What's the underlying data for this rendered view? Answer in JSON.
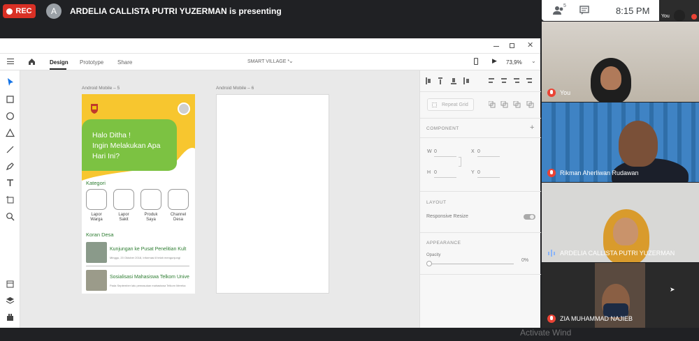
{
  "meet": {
    "rec_label": "REC",
    "presenter_initial": "A",
    "presenting_text": "ARDELIA CALLISTA PUTRI YUZERMAN is presenting",
    "participants_count": "5",
    "time": "8:15 PM",
    "self_mini_label": "You"
  },
  "xd": {
    "tabs": [
      "Design",
      "Prototype",
      "Share"
    ],
    "doc_title": "SMART VILLAGE *",
    "zoom": "73,9%",
    "artboard1_label": "Android Mobile – 5",
    "artboard2_label": "Android Mobile – 6",
    "app": {
      "greeting": "Halo Ditha !",
      "question_line1": "Ingin Melakukan Apa",
      "question_line2": "Hari Ini?",
      "kategori_label": "Kategori",
      "categories": [
        {
          "line1": "Lapor",
          "line2": "Warga"
        },
        {
          "line1": "Lapor",
          "line2": "Sakit"
        },
        {
          "line1": "Produk",
          "line2": "Saya"
        },
        {
          "line1": "Channel",
          "line2": "Desa"
        }
      ],
      "koran_label": "Koran Desa",
      "news": [
        {
          "title": "Kunjungan ke Pusat Penelitian Kult",
          "sub": "Minggu, 20 Oktober 2018, Informasi 8 telah mengunjungi"
        },
        {
          "title": "Sosialisasi Mahasiswa Telkom Unive",
          "sub": "Pada September lalu pemasukan mahasiswa Telkom Mereka"
        }
      ]
    },
    "panel": {
      "repeat_grid": "Repeat Grid",
      "component": "COMPONENT",
      "w_label": "W",
      "w_value": "0",
      "x_label": "X",
      "x_value": "0",
      "h_label": "H",
      "h_value": "0",
      "y_label": "Y",
      "y_value": "0",
      "layout": "LAYOUT",
      "responsive": "Responsive Resize",
      "appearance": "APPEARANCE",
      "opacity_label": "Opacity",
      "opacity_value": "0%"
    }
  },
  "participants": [
    {
      "name": "You"
    },
    {
      "name": "Rikman Aherliwan Rudawan"
    },
    {
      "name": "ARDELIA CALLISTA PUTRI YUZERMAN"
    },
    {
      "name": "ZIA MUHAMMAD NAJIEB"
    }
  ],
  "watermark": "Activate Wind"
}
